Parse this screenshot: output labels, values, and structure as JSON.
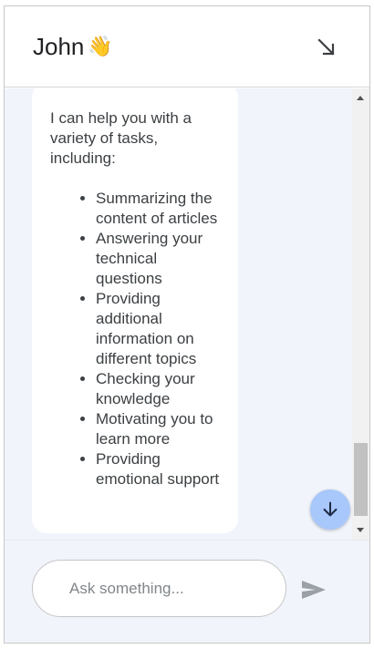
{
  "header": {
    "title": "John",
    "emoji": "👋",
    "minimize_icon": "arrow-down-right-icon"
  },
  "message": {
    "intro": "I can help you with a variety of tasks, including:",
    "items": [
      "Summarizing the content of articles",
      "Answering your technical questions",
      "Providing additional information on different topics",
      "Checking your knowledge",
      "Motivating you to learn more",
      "Providing emotional support"
    ]
  },
  "scroll_down_icon": "arrow-down-icon",
  "composer": {
    "placeholder": "Ask something...",
    "value": "",
    "send_icon": "send-icon"
  },
  "colors": {
    "chat_background": "#f1f4fb",
    "bubble_background": "#ffffff",
    "accent_button": "#a8c7fa",
    "send_icon": "#9aa0a6"
  }
}
